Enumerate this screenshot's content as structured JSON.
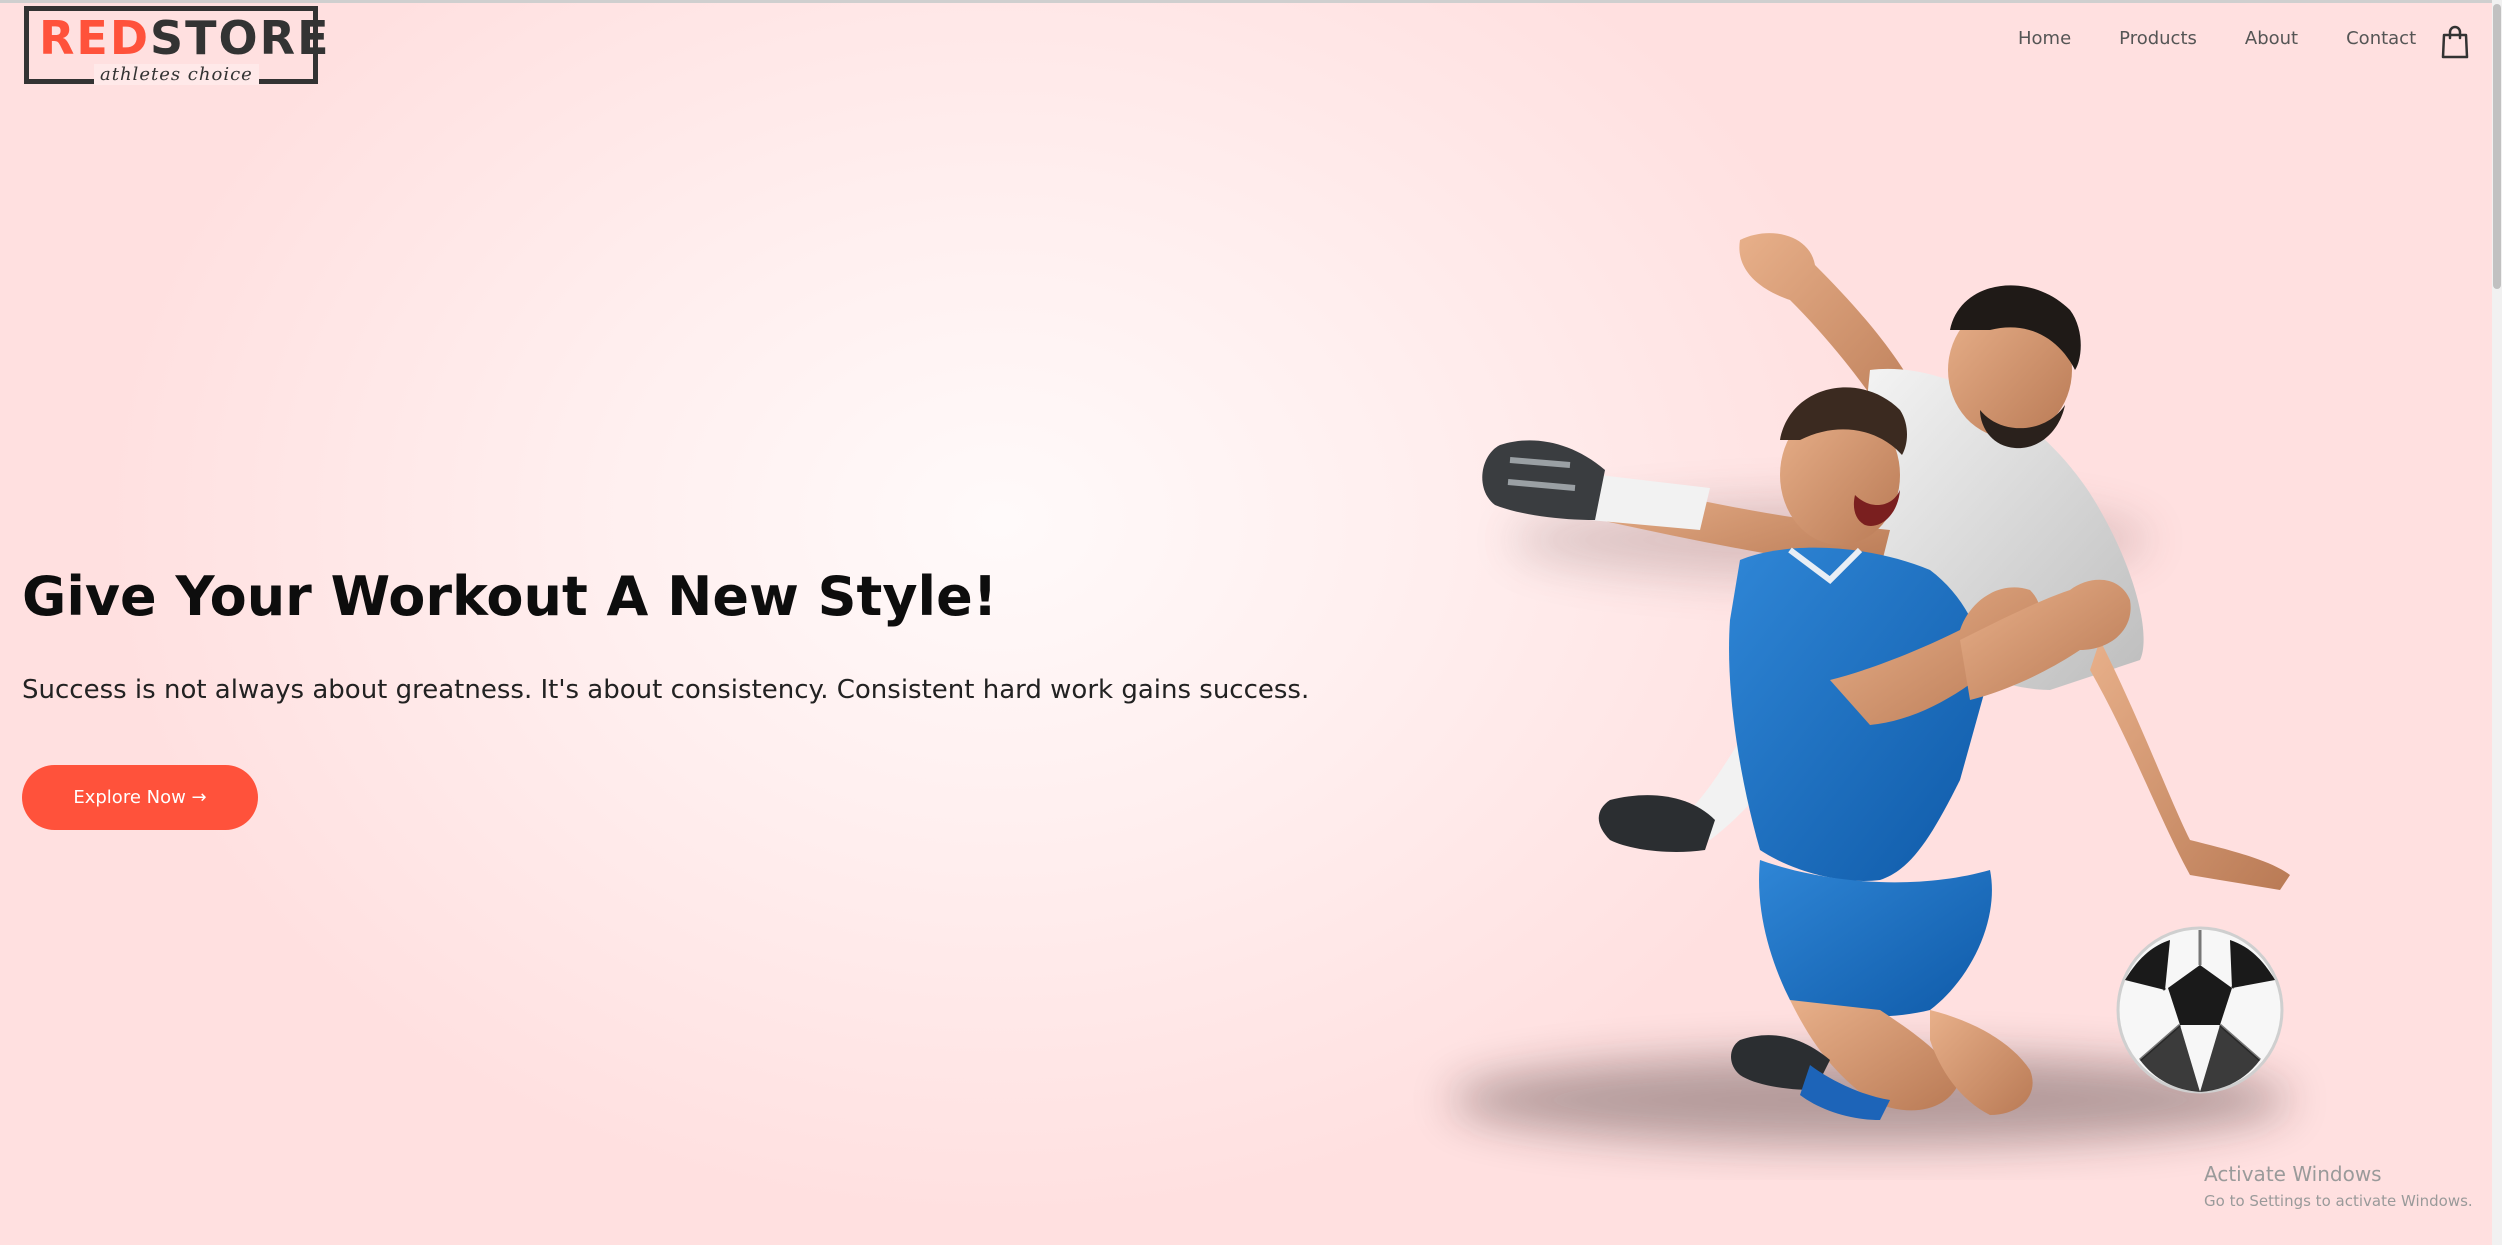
{
  "brand": {
    "logo_red": "RED",
    "logo_dark": "STORE",
    "tagline": "athletes choice"
  },
  "nav": {
    "items": [
      {
        "label": "Home"
      },
      {
        "label": "Products"
      },
      {
        "label": "About"
      },
      {
        "label": "Contact"
      }
    ],
    "cart_icon": "shopping-bag-icon"
  },
  "hero": {
    "title": "Give Your Workout A New Style!",
    "subtitle": "Success is not always about greatness. It's about consistency. Consistent hard work gains success.",
    "button_label": "Explore Now →"
  },
  "watermark": {
    "title": "Activate Windows",
    "subtitle": "Go to Settings to activate Windows."
  },
  "colors": {
    "accent": "#ff523b",
    "background": "#ffe0e0",
    "text": "#0d0d0d"
  }
}
